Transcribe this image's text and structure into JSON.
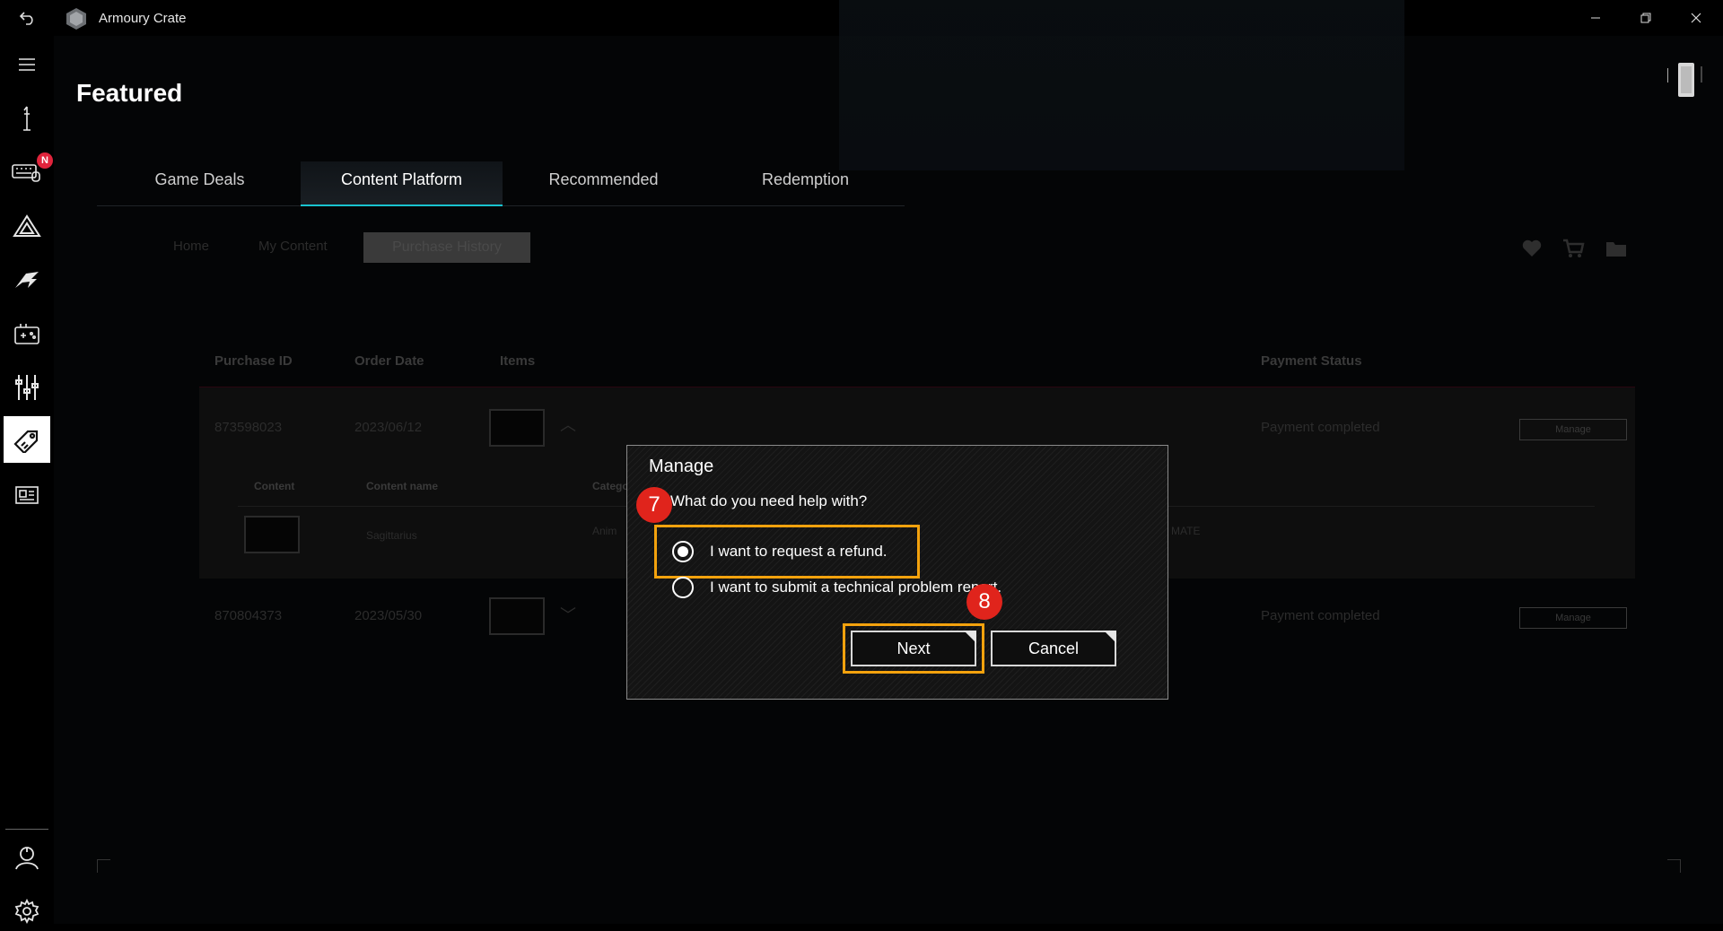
{
  "window": {
    "title": "Armoury Crate",
    "controls": [
      "minimize",
      "restore",
      "close"
    ]
  },
  "sidebar": {
    "icons": [
      "menu-icon",
      "device-icon",
      "keyboard-icon",
      "aura-icon",
      "rog-logo-icon",
      "game-library-icon",
      "scenario-profiles-icon",
      "featured-tag-icon",
      "news-icon",
      "user-center-icon",
      "settings-icon"
    ],
    "badge": "N"
  },
  "page": {
    "title": "Featured",
    "tabs": [
      "Game Deals",
      "Content Platform",
      "Recommended",
      "Redemption"
    ],
    "active_tab": "Content Platform"
  },
  "background": {
    "breadcrumbs": [
      "Home",
      "My Content",
      "Purchase History"
    ],
    "headers": [
      "Purchase ID",
      "Order Date",
      "Items",
      "Payment Status"
    ],
    "subheaders": [
      "Content",
      "Content name",
      "Category"
    ],
    "rows": [
      {
        "id": "873598023",
        "date": "2023/06/12",
        "status": "Payment completed",
        "button": "Manage"
      },
      {
        "id": "870804373",
        "date": "2023/05/30",
        "status": "Payment completed",
        "button": "Manage"
      }
    ],
    "sub_item": {
      "name": "Sagittarius",
      "category": "Anim",
      "extra": "MATE"
    }
  },
  "modal": {
    "title": "Manage",
    "question": "What do you need help with?",
    "options": [
      {
        "label": "I want to request a refund.",
        "selected": true
      },
      {
        "label": "I want to submit a technical problem report.",
        "selected": false
      }
    ],
    "next_label": "Next",
    "cancel_label": "Cancel"
  },
  "annotations": {
    "step7": "7",
    "step8": "8",
    "highlight_color": "#f3a20d",
    "badge_color": "#e0241c"
  },
  "colors": {
    "accent": "#19c3cf",
    "background": "#000000"
  }
}
